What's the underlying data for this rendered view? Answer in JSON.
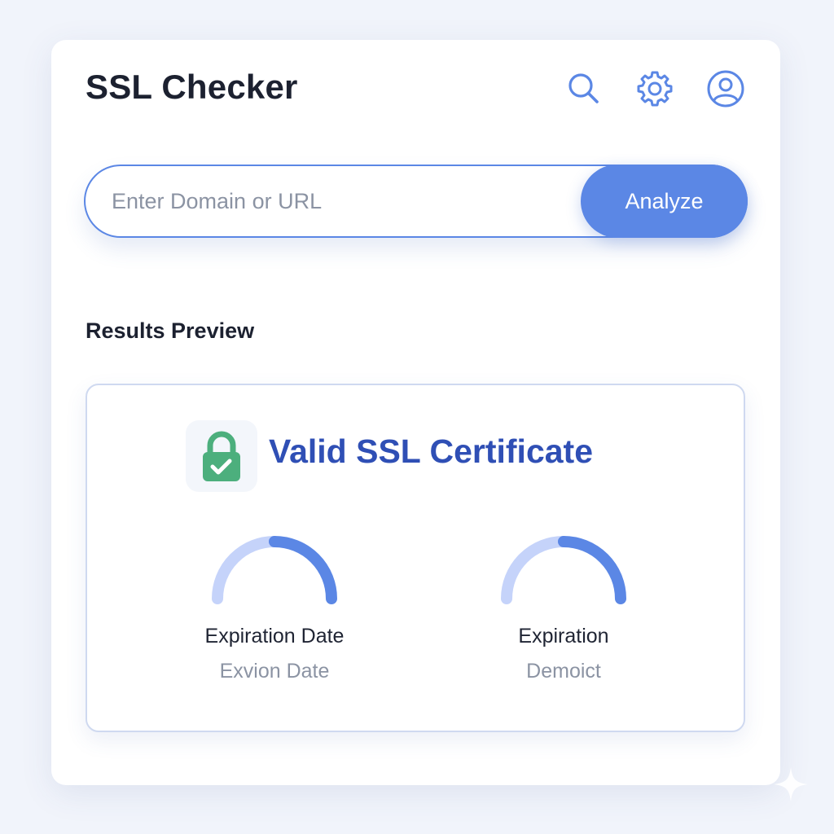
{
  "header": {
    "title": "SSL Checker",
    "icons": [
      "search-icon",
      "gear-icon",
      "user-icon"
    ]
  },
  "search": {
    "placeholder": "Enter Domain or URL",
    "value": "",
    "button_label": "Analyze"
  },
  "results": {
    "section_title": "Results Preview",
    "status": "Valid SSL Certificate",
    "status_icon": "lock-check-icon",
    "gauges": [
      {
        "label": "Expiration Date",
        "sub": "Exvion Date",
        "fill": 0.5
      },
      {
        "label": "Expiration",
        "sub": "Demoict",
        "fill": 0.5
      }
    ]
  },
  "colors": {
    "accent": "#5b87e5",
    "status_text": "#2f4fb5",
    "lock": "#4caf7d",
    "gauge_track": "#c5d3fa",
    "gauge_fill": "#5b87e5"
  }
}
